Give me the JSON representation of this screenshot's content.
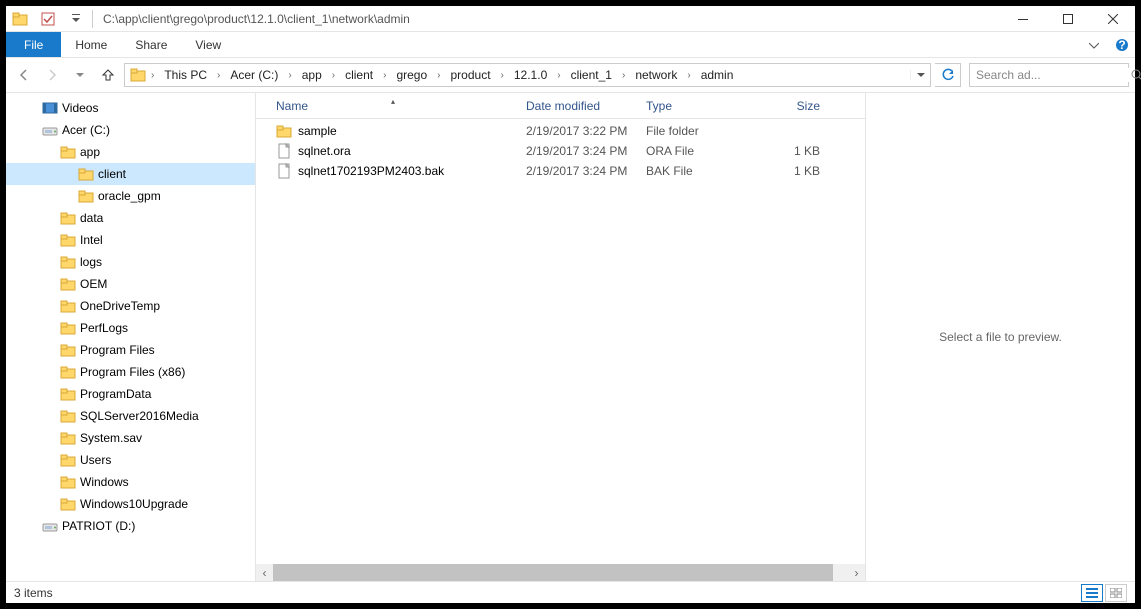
{
  "title_path": "C:\\app\\client\\grego\\product\\12.1.0\\client_1\\network\\admin",
  "ribbon": {
    "file": "File",
    "home": "Home",
    "share": "Share",
    "view": "View"
  },
  "breadcrumbs": [
    "This PC",
    "Acer (C:)",
    "app",
    "client",
    "grego",
    "product",
    "12.1.0",
    "client_1",
    "network",
    "admin"
  ],
  "search_placeholder": "Search ad...",
  "tree": [
    {
      "label": "Videos",
      "depth": 1,
      "icon": "video"
    },
    {
      "label": "Acer (C:)",
      "depth": 1,
      "icon": "drive"
    },
    {
      "label": "app",
      "depth": 2,
      "icon": "folder"
    },
    {
      "label": "client",
      "depth": 3,
      "icon": "folder",
      "selected": true
    },
    {
      "label": "oracle_gpm",
      "depth": 3,
      "icon": "folder"
    },
    {
      "label": "data",
      "depth": 2,
      "icon": "folder"
    },
    {
      "label": "Intel",
      "depth": 2,
      "icon": "folder"
    },
    {
      "label": "logs",
      "depth": 2,
      "icon": "folder"
    },
    {
      "label": "OEM",
      "depth": 2,
      "icon": "folder"
    },
    {
      "label": "OneDriveTemp",
      "depth": 2,
      "icon": "folder"
    },
    {
      "label": "PerfLogs",
      "depth": 2,
      "icon": "folder"
    },
    {
      "label": "Program Files",
      "depth": 2,
      "icon": "folder"
    },
    {
      "label": "Program Files (x86)",
      "depth": 2,
      "icon": "folder"
    },
    {
      "label": "ProgramData",
      "depth": 2,
      "icon": "folder"
    },
    {
      "label": "SQLServer2016Media",
      "depth": 2,
      "icon": "folder"
    },
    {
      "label": "System.sav",
      "depth": 2,
      "icon": "folder"
    },
    {
      "label": "Users",
      "depth": 2,
      "icon": "folder"
    },
    {
      "label": "Windows",
      "depth": 2,
      "icon": "folder"
    },
    {
      "label": "Windows10Upgrade",
      "depth": 2,
      "icon": "folder"
    },
    {
      "label": "PATRIOT (D:)",
      "depth": 1,
      "icon": "drive2"
    }
  ],
  "columns": {
    "name": "Name",
    "date": "Date modified",
    "type": "Type",
    "size": "Size"
  },
  "rows": [
    {
      "icon": "folder",
      "name": "sample",
      "date": "2/19/2017 3:22 PM",
      "type": "File folder",
      "size": ""
    },
    {
      "icon": "file",
      "name": "sqlnet.ora",
      "date": "2/19/2017 3:24 PM",
      "type": "ORA File",
      "size": "1 KB"
    },
    {
      "icon": "file",
      "name": "sqlnet1702193PM2403.bak",
      "date": "2/19/2017 3:24 PM",
      "type": "BAK File",
      "size": "1 KB"
    }
  ],
  "preview_text": "Select a file to preview.",
  "status_text": "3 items"
}
